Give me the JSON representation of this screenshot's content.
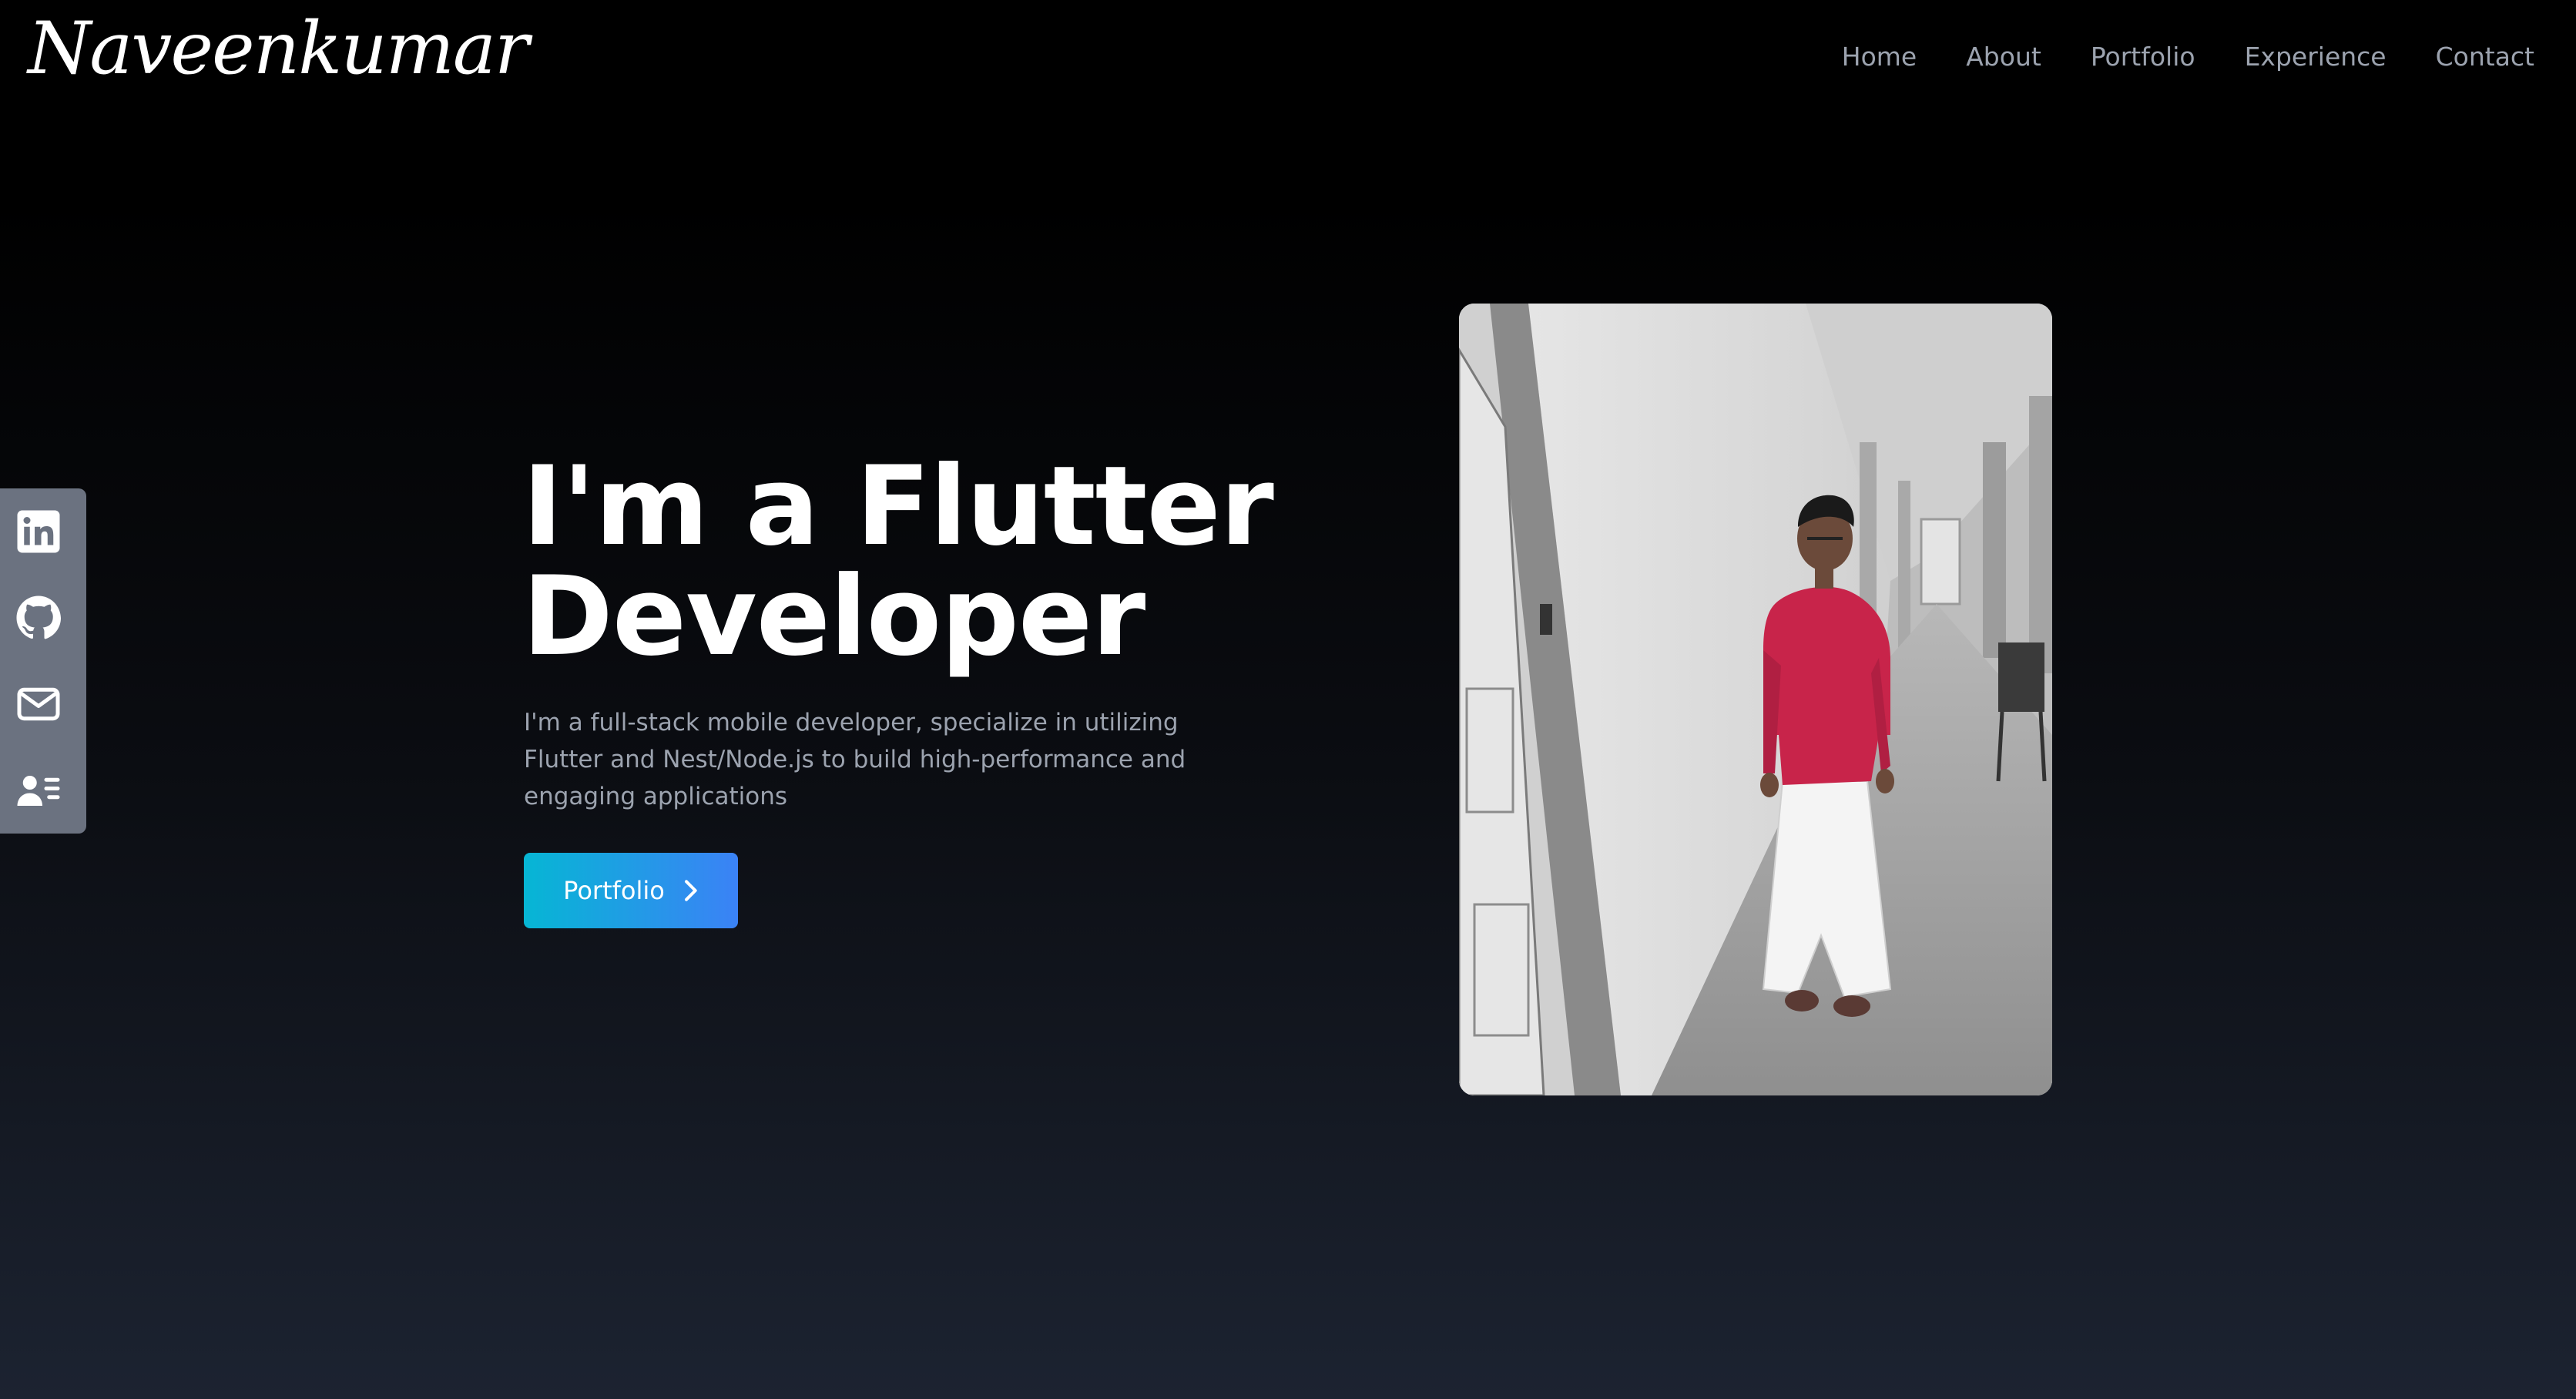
{
  "header": {
    "logo": "Naveenkumar",
    "nav": [
      "Home",
      "About",
      "Portfolio",
      "Experience",
      "Contact"
    ]
  },
  "social": {
    "icons": [
      "linkedin-icon",
      "github-icon",
      "mail-icon",
      "resume-icon"
    ],
    "background": "#6b7280"
  },
  "hero": {
    "title_line1": "I'm a Flutter",
    "title_line2": "Developer",
    "subtitle": "I'm a full-stack mobile developer, specialize in utilizing Flutter and Nest/Node.js to build high-performance and engaging applications",
    "button_label": "Portfolio",
    "button_gradient": [
      "#06b6d4",
      "#3b82f6"
    ]
  },
  "photo": {
    "subject": "Person in red shirt and white dhoti standing in a corridor"
  },
  "colors": {
    "background_top": "#000000",
    "background_bottom": "#1c2331",
    "muted_text": "#9ca3af"
  }
}
